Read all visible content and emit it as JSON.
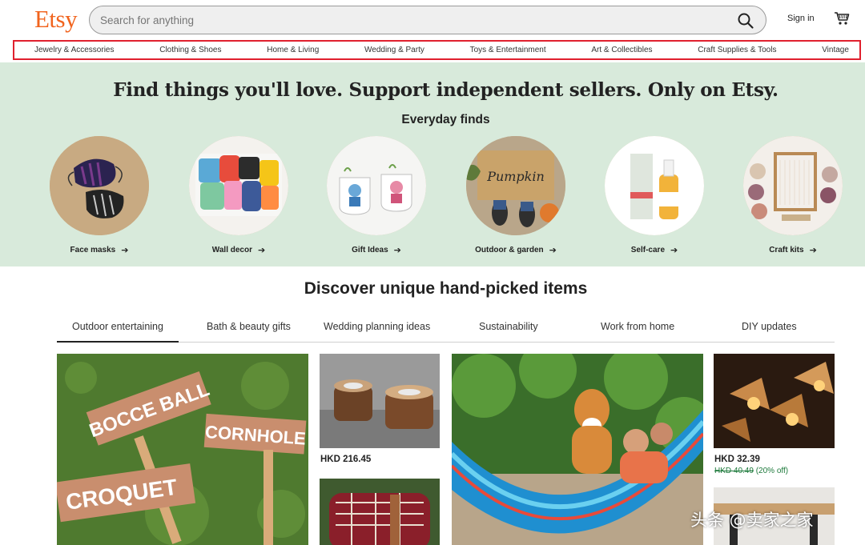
{
  "brand": {
    "logo": "Etsy",
    "accent": "#F1641E"
  },
  "search": {
    "placeholder": "Search for anything",
    "icon": "search-icon"
  },
  "header": {
    "signin_label": "Sign in",
    "cart_icon": "cart-icon"
  },
  "categories": [
    "Jewelry & Accessories",
    "Clothing & Shoes",
    "Home & Living",
    "Wedding & Party",
    "Toys & Entertainment",
    "Art & Collectibles",
    "Craft Supplies & Tools",
    "Vintage"
  ],
  "hero": {
    "title": "Find things you'll love. Support independent sellers. Only on Etsy.",
    "subtitle": "Everyday finds",
    "background": "#d8eadb",
    "finds": [
      {
        "label": "Face masks"
      },
      {
        "label": "Wall decor"
      },
      {
        "label": "Gift Ideas"
      },
      {
        "label": "Outdoor & garden"
      },
      {
        "label": "Self-care"
      },
      {
        "label": "Craft kits"
      }
    ],
    "arrow": "➔"
  },
  "discover": {
    "title": "Discover unique hand-picked items",
    "tabs": [
      "Outdoor entertaining",
      "Bath & beauty gifts",
      "Wedding planning ideas",
      "Sustainability",
      "Work from home",
      "DIY updates"
    ],
    "active_tab": "Outdoor entertaining"
  },
  "products": {
    "signs": [
      "BOCCE BALL",
      "CORNHOLE",
      "CROQUET"
    ],
    "candle_price": "HKD 216.45",
    "lamp_price": "HKD 32.39",
    "lamp_old_price": "HKD 40.49",
    "lamp_discount": "(20% off)"
  },
  "watermark": "头条 @卖家之家"
}
